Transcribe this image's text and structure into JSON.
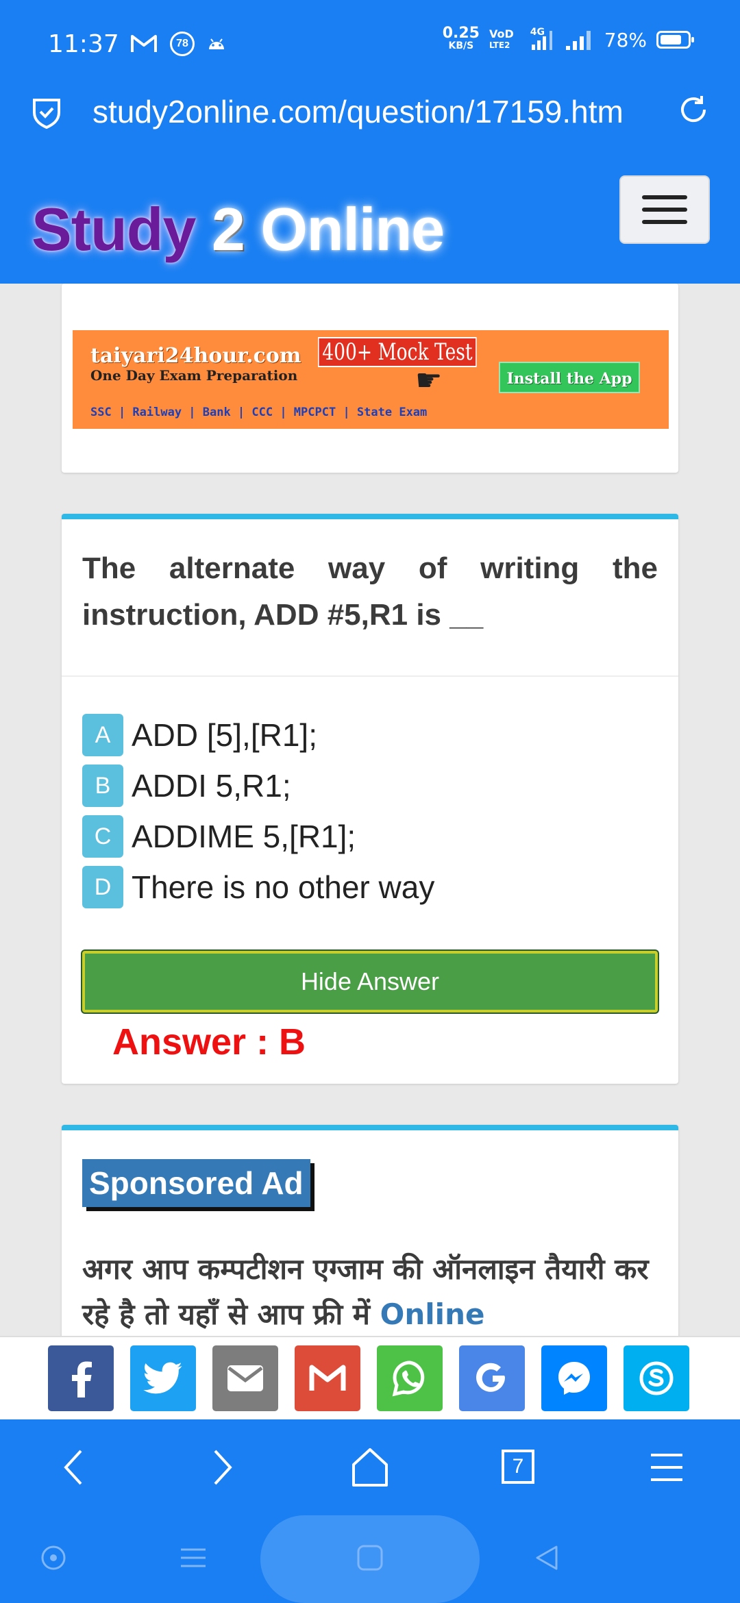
{
  "status_bar": {
    "time": "11:37",
    "notif_badge": "78",
    "net_speed_value": "0.25",
    "net_speed_unit": "KB/S",
    "volte_top": "VoD",
    "volte_bottom": "LTE2",
    "network": "4G",
    "battery": "78%",
    "battery_level": 0.78
  },
  "url_bar": {
    "url": "study2online.com/question/17159.htm"
  },
  "header": {
    "brand_part1": "Study",
    "brand_part2": "2",
    "brand_part3": "Online"
  },
  "banner_ad": {
    "site": "taiyari24hour.com",
    "subtitle": "One Day Exam Preparation",
    "mock": "400+ Mock Test",
    "install": "Install the App",
    "categories": "SSC | Railway | Bank | CCC | MPCPCT | State Exam"
  },
  "question": {
    "text": "The alternate way of writing the instruction, ADD #5,R1 is __",
    "options": [
      {
        "letter": "A",
        "text": "ADD [5],[R1];"
      },
      {
        "letter": "B",
        "text": "ADDI 5,R1;"
      },
      {
        "letter": "C",
        "text": "ADDIME 5,[R1];"
      },
      {
        "letter": "D",
        "text": "There is no other way"
      }
    ],
    "hide_answer_label": "Hide Answer",
    "answer": "Answer : B"
  },
  "sponsored": {
    "badge": "Sponsored Ad",
    "text": "अगर आप कम्पटीशन एग्जाम की ऑनलाइन तैयारी कर रहे है तो यहाँ से आप फ्री में",
    "link": "Online"
  },
  "share": [
    {
      "name": "facebook",
      "color": "#3b5998"
    },
    {
      "name": "twitter",
      "color": "#1da1f2"
    },
    {
      "name": "email",
      "color": "#7d7d7d"
    },
    {
      "name": "gmail",
      "color": "#dd4b39"
    },
    {
      "name": "whatsapp",
      "color": "#4dc247"
    },
    {
      "name": "google",
      "color": "#4a86e8"
    },
    {
      "name": "messenger",
      "color": "#0084ff"
    },
    {
      "name": "skype",
      "color": "#00aff0"
    }
  ],
  "browser_nav": {
    "tab_count": "7"
  },
  "colors": {
    "primary": "#1a7ff2",
    "accent_border": "#2eb8e6",
    "option_badge": "#5bc0de",
    "hide_button": "#4a9e46",
    "answer": "#ee1111"
  }
}
